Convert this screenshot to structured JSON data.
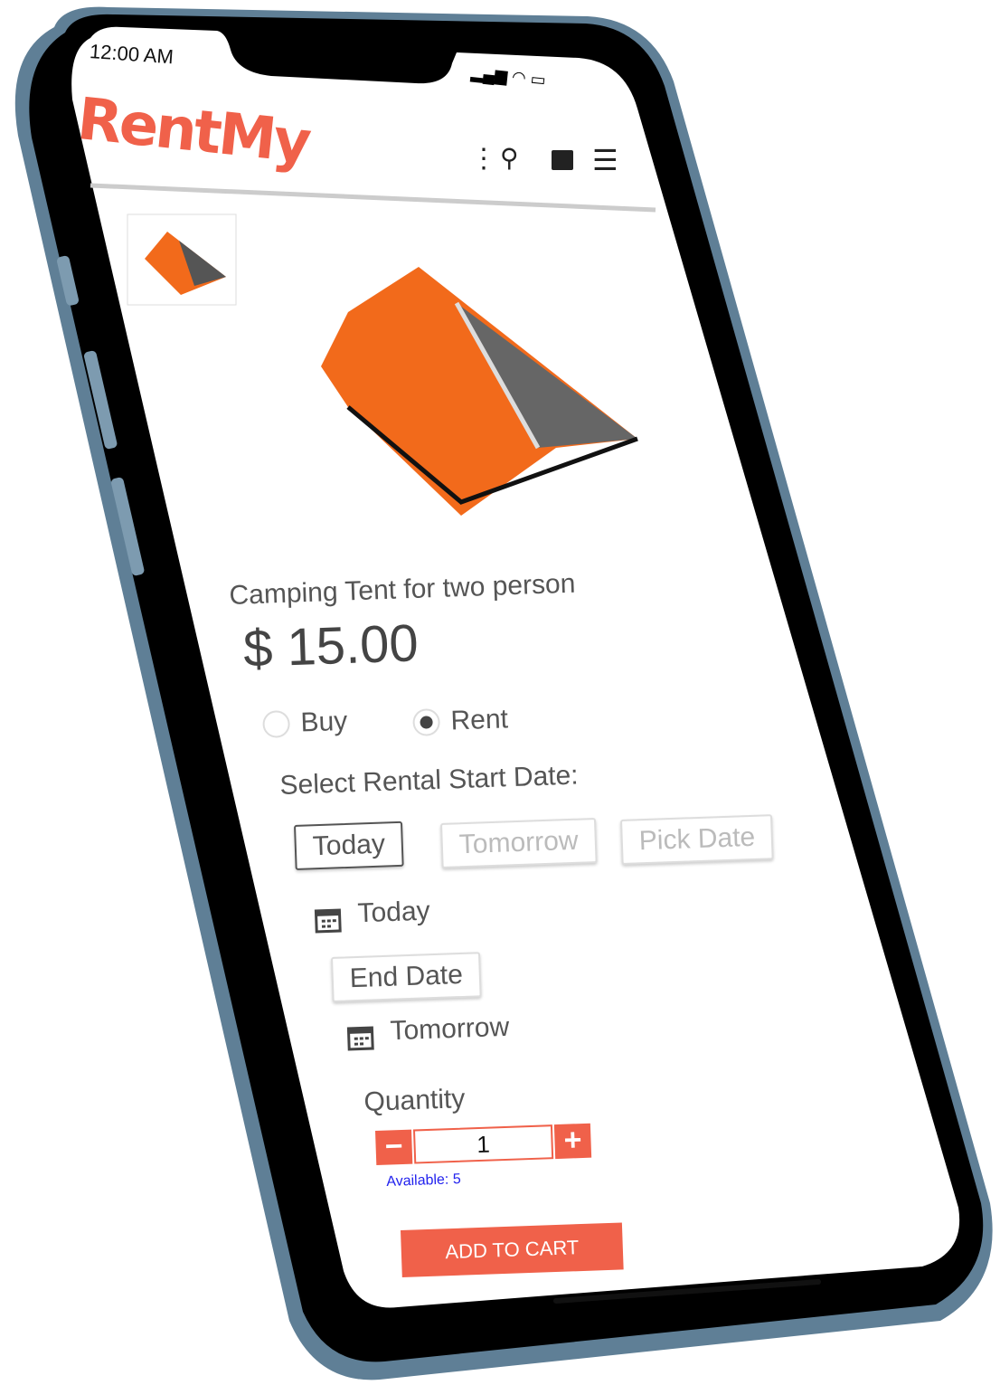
{
  "status_bar": {
    "time": "12:00 AM",
    "icons": [
      "signal-icon",
      "wifi-icon",
      "battery-icon"
    ]
  },
  "header": {
    "logo": "RentMy",
    "icons": [
      "more-vertical-icon",
      "search-icon",
      "shopping-bag-icon",
      "menu-icon"
    ]
  },
  "product": {
    "title": "Camping Tent for two person",
    "price": "$ 15.00",
    "options": [
      {
        "label": "Buy",
        "selected": false
      },
      {
        "label": "Rent",
        "selected": true
      }
    ]
  },
  "rental": {
    "start_label": "Select Rental Start Date:",
    "date_buttons": [
      {
        "label": "Today",
        "active": true
      },
      {
        "label": "Tomorrow",
        "active": false
      },
      {
        "label": "Pick Date",
        "active": false
      }
    ],
    "start_value": "Today",
    "end_label": "End Date",
    "end_value": "Tomorrow"
  },
  "quantity": {
    "label": "Quantity",
    "minus": "−",
    "value": "1",
    "plus": "+",
    "available": "Available: 5"
  },
  "cart": {
    "label": "ADD TO CART"
  },
  "colors": {
    "brand": "#f0614a",
    "available": "#2222ee",
    "tent": "#f26a1b"
  }
}
